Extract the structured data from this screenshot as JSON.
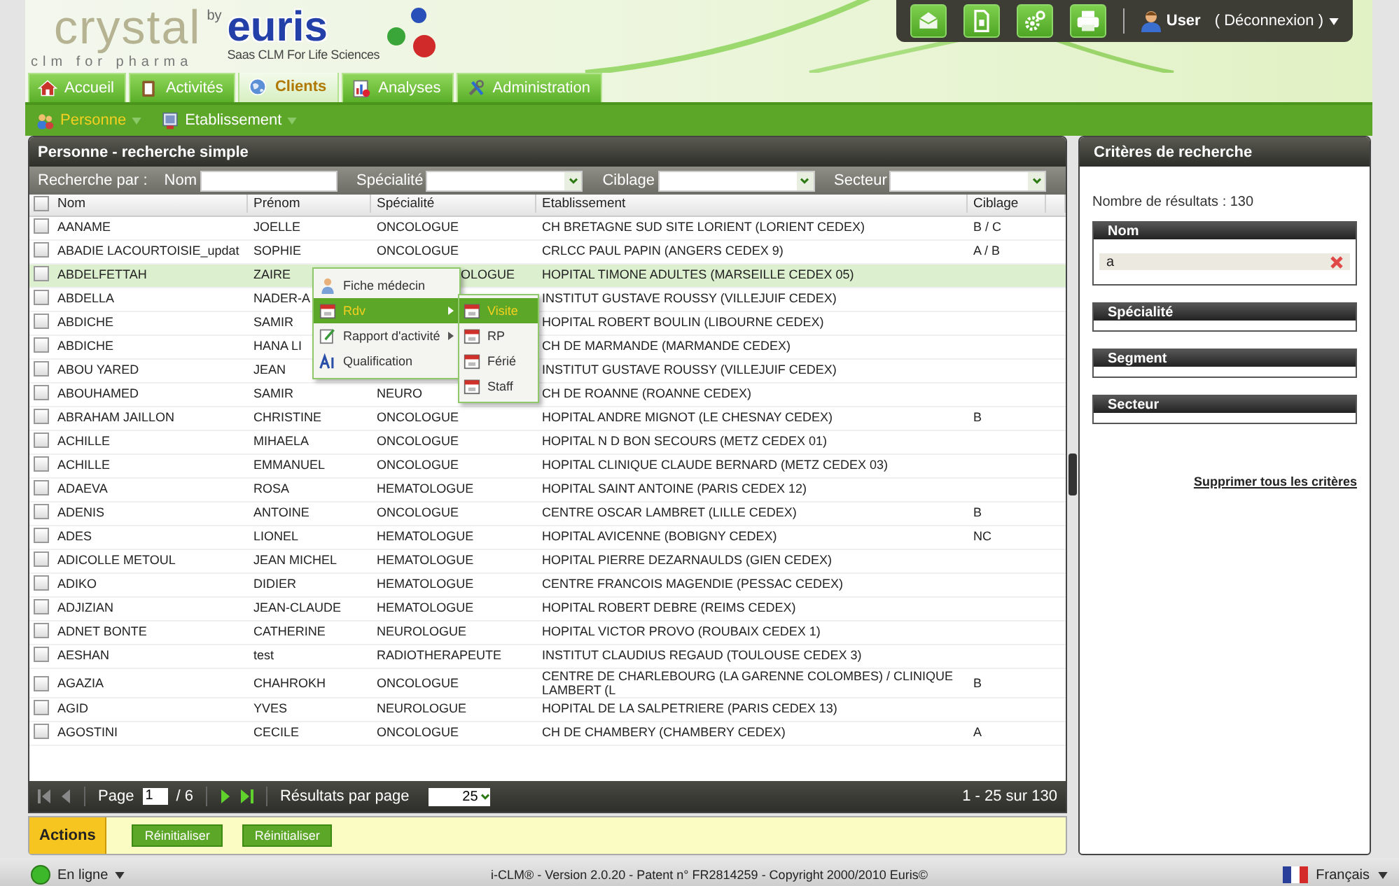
{
  "header": {
    "logo": "crystal",
    "logo_tagline": "clm for pharma",
    "by": "by",
    "brand": "euris",
    "brand_tagline": "Saas CLM For Life Sciences"
  },
  "toolbar": {
    "buttons": [
      {
        "kind": "mail"
      },
      {
        "kind": "document"
      },
      {
        "kind": "gear"
      },
      {
        "kind": "printer"
      }
    ],
    "user": "User",
    "logout": "( Déconnexion )"
  },
  "tabs": [
    {
      "label": "Accueil",
      "kind": "home",
      "selected": false
    },
    {
      "label": "Activités",
      "kind": "clipboard",
      "selected": false
    },
    {
      "label": "Clients",
      "kind": "globe",
      "selected": true
    },
    {
      "label": "Analyses",
      "kind": "chart",
      "selected": false
    },
    {
      "label": "Administration",
      "kind": "tools",
      "selected": false
    }
  ],
  "subnav": [
    {
      "label": "Personne",
      "kind": "people",
      "selected": true
    },
    {
      "label": "Etablissement",
      "kind": "building",
      "selected": false
    }
  ],
  "panel": {
    "title": "Personne - recherche simple",
    "filter_label": "Recherche par :",
    "filters": [
      {
        "label": "Nom",
        "kind": "text"
      },
      {
        "label": "Spécialité",
        "kind": "select"
      },
      {
        "label": "Ciblage",
        "kind": "select"
      },
      {
        "label": "Secteur",
        "kind": "select"
      }
    ]
  },
  "table": {
    "all_checked": false,
    "columns": [
      "Nom",
      "Prénom",
      "Spécialité",
      "Etablissement",
      "Ciblage"
    ],
    "rows": [
      {
        "nom": "AANAME",
        "prenom": "JOELLE",
        "specialite": "ONCOLOGUE",
        "etablissement": "CH BRETAGNE SUD SITE LORIENT (LORIENT CEDEX)",
        "ciblage": "B / C",
        "checked": false,
        "selected": false
      },
      {
        "nom": "ABADIE LACOURTOISIE_updat",
        "prenom": "SOPHIE",
        "specialite": "ONCOLOGUE",
        "etablissement": "CRLCC PAUL PAPIN (ANGERS CEDEX 9)",
        "ciblage": "A / B",
        "checked": false,
        "selected": false
      },
      {
        "nom": "ABDELFETTAH",
        "prenom": "ZAIRE",
        "specialite": "OLOGUE",
        "etablissement": "HOPITAL TIMONE ADULTES (MARSEILLE CEDEX 05)",
        "checked": false,
        "selected": true
      },
      {
        "nom": "ABDELLA",
        "prenom": "NADER-A",
        "etablissement": "INSTITUT GUSTAVE ROUSSY (VILLEJUIF CEDEX)",
        "checked": false,
        "selected": false
      },
      {
        "nom": "ABDICHE",
        "prenom": "SAMIR",
        "etablissement": "HOPITAL ROBERT BOULIN (LIBOURNE CEDEX)",
        "checked": false,
        "selected": false
      },
      {
        "nom": "ABDICHE",
        "prenom": "HANA LI",
        "etablissement": "CH DE MARMANDE (MARMANDE CEDEX)",
        "checked": false,
        "selected": false
      },
      {
        "nom": "ABOU YARED",
        "prenom": "JEAN",
        "etablissement": "INSTITUT GUSTAVE ROUSSY (VILLEJUIF CEDEX)",
        "checked": false,
        "selected": false
      },
      {
        "nom": "ABOUHAMED",
        "prenom": "SAMIR",
        "specialite": "NEURO",
        "etablissement": "CH DE ROANNE (ROANNE CEDEX)",
        "checked": false,
        "selected": false
      },
      {
        "nom": "ABRAHAM JAILLON",
        "prenom": "CHRISTINE",
        "specialite": "ONCOLOGUE",
        "etablissement": "HOPITAL ANDRE MIGNOT (LE CHESNAY CEDEX)",
        "ciblage": "B",
        "checked": false,
        "selected": false
      },
      {
        "nom": "ACHILLE",
        "prenom": "MIHAELA",
        "specialite": "ONCOLOGUE",
        "etablissement": "HOPITAL N D BON SECOURS (METZ CEDEX 01)",
        "checked": false,
        "selected": false
      },
      {
        "nom": "ACHILLE",
        "prenom": "EMMANUEL",
        "specialite": "ONCOLOGUE",
        "etablissement": "HOPITAL CLINIQUE CLAUDE BERNARD (METZ CEDEX 03)",
        "checked": false,
        "selected": false
      },
      {
        "nom": "ADAEVA",
        "prenom": "ROSA",
        "specialite": "HEMATOLOGUE",
        "etablissement": "HOPITAL SAINT ANTOINE (PARIS CEDEX 12)",
        "checked": false,
        "selected": false
      },
      {
        "nom": "ADENIS",
        "prenom": "ANTOINE",
        "specialite": "ONCOLOGUE",
        "etablissement": "CENTRE OSCAR LAMBRET (LILLE CEDEX)",
        "ciblage": "B",
        "checked": false,
        "selected": false
      },
      {
        "nom": "ADES",
        "prenom": "LIONEL",
        "specialite": "HEMATOLOGUE",
        "etablissement": "HOPITAL AVICENNE (BOBIGNY CEDEX)",
        "ciblage": "NC",
        "checked": false,
        "selected": false
      },
      {
        "nom": "ADICOLLE METOUL",
        "prenom": "JEAN MICHEL",
        "specialite": "HEMATOLOGUE",
        "etablissement": "HOPITAL PIERRE DEZARNAULDS (GIEN CEDEX)",
        "checked": false,
        "selected": false
      },
      {
        "nom": "ADIKO",
        "prenom": "DIDIER",
        "specialite": "HEMATOLOGUE",
        "etablissement": "CENTRE FRANCOIS MAGENDIE (PESSAC CEDEX)",
        "checked": false,
        "selected": false
      },
      {
        "nom": "ADJIZIAN",
        "prenom": "JEAN-CLAUDE",
        "specialite": "HEMATOLOGUE",
        "etablissement": "HOPITAL ROBERT DEBRE (REIMS CEDEX)",
        "checked": false,
        "selected": false
      },
      {
        "nom": "ADNET BONTE",
        "prenom": "CATHERINE",
        "specialite": "NEUROLOGUE",
        "etablissement": "HOPITAL VICTOR PROVO (ROUBAIX CEDEX 1)",
        "checked": false,
        "selected": false
      },
      {
        "nom": "AESHAN",
        "prenom": "test",
        "specialite": "RADIOTHERAPEUTE",
        "etablissement": "INSTITUT CLAUDIUS REGAUD (TOULOUSE CEDEX 3)",
        "checked": false,
        "selected": false
      },
      {
        "nom": "AGAZIA",
        "prenom": "CHAHROKH",
        "specialite": "ONCOLOGUE",
        "etablissement": "CENTRE DE CHARLEBOURG (LA GARENNE COLOMBES) / CLINIQUE LAMBERT (L",
        "ciblage": "B",
        "checked": false,
        "selected": false
      },
      {
        "nom": "AGID",
        "prenom": "YVES",
        "specialite": "NEUROLOGUE",
        "etablissement": "HOPITAL DE LA SALPETRIERE (PARIS CEDEX 13)",
        "checked": false,
        "selected": false
      },
      {
        "nom": "AGOSTINI",
        "prenom": "CECILE",
        "specialite": "ONCOLOGUE",
        "etablissement": "CH DE CHAMBERY (CHAMBERY CEDEX)",
        "ciblage": "A",
        "checked": false,
        "selected": false
      }
    ]
  },
  "context_menu": {
    "items": [
      {
        "label": "Fiche médecin",
        "kind": "doctor",
        "submenu": false,
        "selected": false
      },
      {
        "label": "Rdv",
        "kind": "calendar",
        "submenu": true,
        "selected": true
      },
      {
        "label": "Rapport d'activité",
        "kind": "report",
        "submenu": true,
        "selected": false
      },
      {
        "label": "Qualification",
        "kind": "text",
        "submenu": false,
        "selected": false
      }
    ],
    "submenu": [
      {
        "label": "Visite",
        "selected": true
      },
      {
        "label": "RP",
        "selected": false
      },
      {
        "label": "Férié",
        "selected": false
      },
      {
        "label": "Staff",
        "selected": false
      }
    ]
  },
  "pager": {
    "page_label": "Page",
    "page": "1",
    "page_count": "/ 6",
    "per_page_label": "Résultats par page",
    "per_page": "25",
    "range": "1 - 25 sur 130"
  },
  "actions": {
    "label": "Actions",
    "buttons": [
      "Réinitialiser",
      "Réinitialiser"
    ]
  },
  "criteria": {
    "title": "Critères de recherche",
    "count": "Nombre de résultats : 130",
    "groups": [
      {
        "title": "Nom",
        "values": [
          "a"
        ]
      },
      {
        "title": "Spécialité"
      },
      {
        "title": "Segment"
      },
      {
        "title": "Secteur"
      }
    ],
    "clear": "Supprimer tous les critères"
  },
  "footer": {
    "status": "En ligne",
    "copyright": "i-CLM® - Version 2.0.20 - Patent n° FR2814259 - Copyright 2000/2010 Euris©",
    "language": "Français"
  }
}
